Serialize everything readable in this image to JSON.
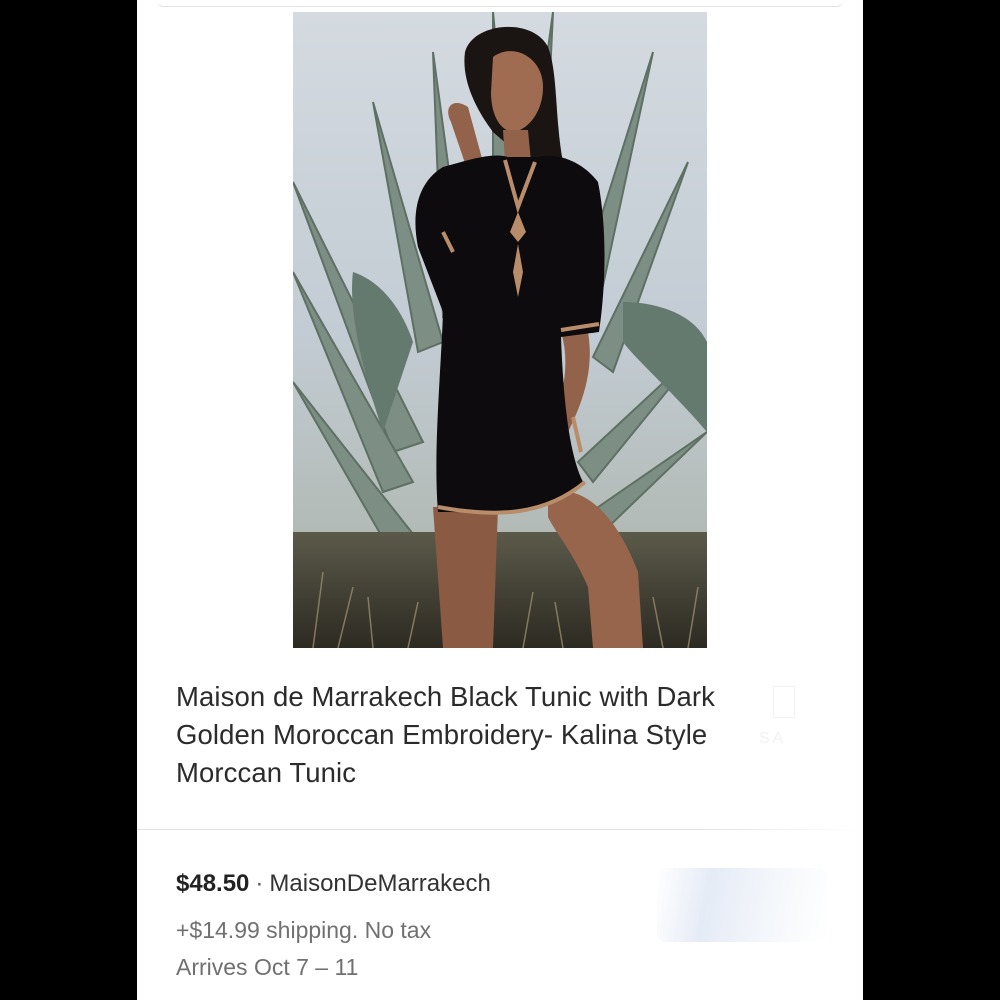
{
  "listing": {
    "image_alt": "Model wearing black tunic with gold embroidery in front of agave plant",
    "title": "Maison de Marrakech Black Tunic with Dark Golden Moroccan Embroidery- Kalina Style Morccan Tunic",
    "price": "$48.50",
    "separator": "·",
    "seller": "MaisonDeMarrakech",
    "shipping": "+$14.99 shipping. No tax",
    "arrival": "Arrives Oct 7 – 11"
  },
  "colors": {
    "background": "#000000",
    "card": "#ffffff",
    "title_text": "#2b2b2b",
    "secondary_text": "#707070",
    "tunic": "#0d0b0e",
    "embroidery": "#b98d6a"
  },
  "icons": {
    "sale_badge": "tag-icon"
  }
}
